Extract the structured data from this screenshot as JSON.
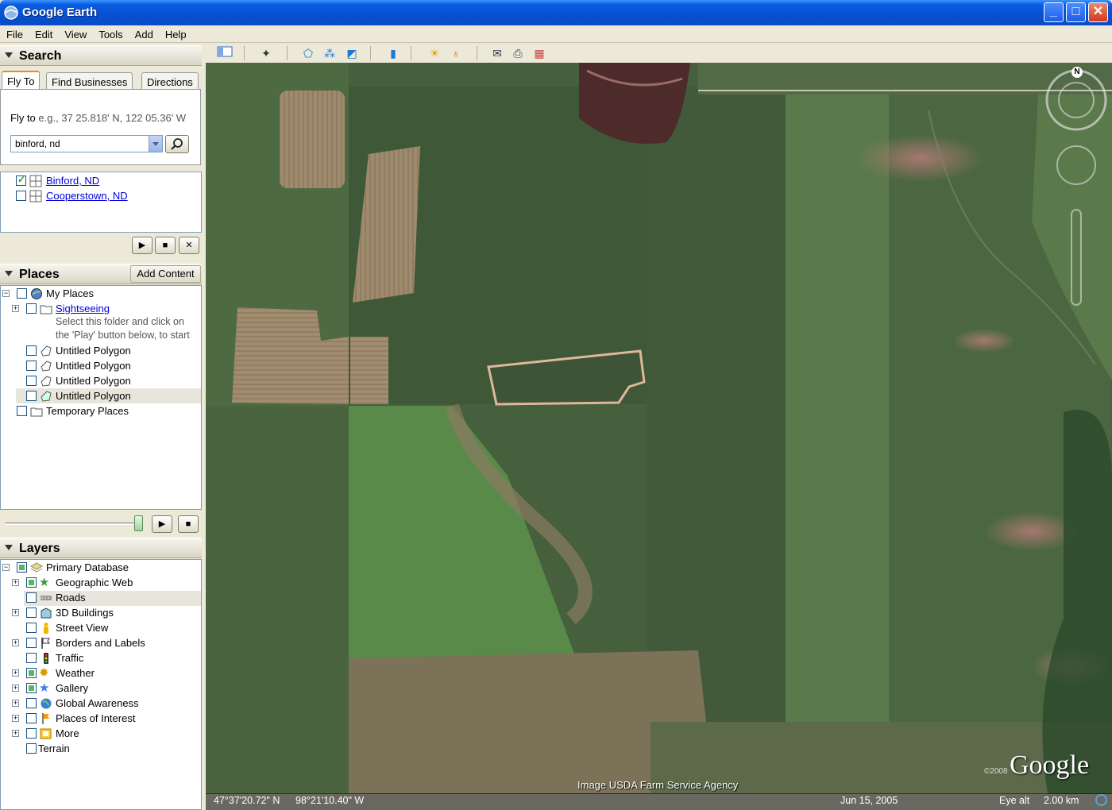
{
  "window": {
    "title": "Google Earth",
    "min": "_",
    "max": "□",
    "close": "✕"
  },
  "menu": [
    "File",
    "Edit",
    "View",
    "Tools",
    "Add",
    "Help"
  ],
  "search": {
    "header": "Search",
    "tabs": [
      "Fly To",
      "Find Businesses",
      "Directions"
    ],
    "fly_label": "Fly to",
    "fly_hint": "e.g., 37 25.818' N, 122 05.36' W",
    "input_value": "binford, nd",
    "results": [
      {
        "label": "Binford, ND",
        "checked": true
      },
      {
        "label": "Cooperstown, ND",
        "checked": false
      }
    ]
  },
  "places": {
    "header": "Places",
    "add_content": "Add Content",
    "my_places": "My Places",
    "sightseeing": "Sightseeing",
    "sightseeing_desc": "Select this folder and click on the 'Play' button below, to start",
    "polygons": [
      "Untitled Polygon",
      "Untitled Polygon",
      "Untitled Polygon",
      "Untitled Polygon"
    ],
    "temporary": "Temporary Places"
  },
  "layers": {
    "header": "Layers",
    "root": "Primary Database",
    "items": [
      "Geographic Web",
      "Roads",
      "3D Buildings",
      "Street View",
      "Borders and Labels",
      "Traffic",
      "Weather",
      "Gallery",
      "Global Awareness",
      "Places of Interest",
      "More"
    ],
    "terrain": "Terrain"
  },
  "map": {
    "credit": "Image USDA Farm Service Agency",
    "logo": "Google",
    "copyright": "©2008",
    "compass_n": "N"
  },
  "status": {
    "lat": "47°37'20.72\" N",
    "lon": "98°21'10.40\" W",
    "date": "Jun 15, 2005",
    "eye_label": "Eye alt",
    "eye_value": "2.00 km"
  },
  "colors": {
    "titlebar": "#0a5ddf",
    "tab_accent": "#e68b2c",
    "link": "#0000e0"
  }
}
